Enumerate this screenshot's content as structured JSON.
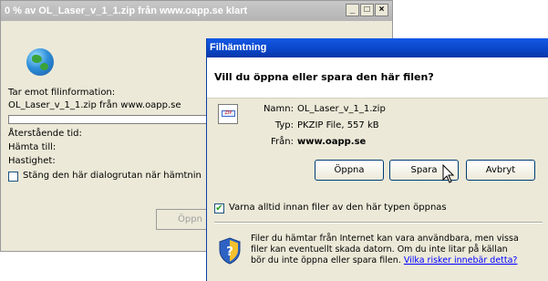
{
  "background_window": {
    "title": "0 % av OL_Laser_v_1_1.zip från www.oapp.se klart",
    "receiving_label": "Tar emot filinformation:",
    "receiving_value": "OL_Laser_v_1_1.zip från www.oapp.se",
    "time_left_label": "Återstående tid:",
    "download_to_label": "Hämta till:",
    "speed_label": "Hastighet:",
    "close_when_done_label": "Stäng den här dialogrutan när hämtnin",
    "open_button_label": "Öppn",
    "progress": 0
  },
  "dialog": {
    "title": "Filhämtning",
    "question": "Vill du öppna eller spara den här filen?",
    "name_label": "Namn:",
    "name_value": "OL_Laser_v_1_1.zip",
    "type_label": "Typ:",
    "type_value": "PKZIP File, 557 kB",
    "from_label": "Från:",
    "from_value": "www.oapp.se",
    "open_button": "Öppna",
    "save_button": "Spara",
    "cancel_button": "Avbryt",
    "always_ask_label": "Varna alltid innan filer av den här typen öppnas",
    "always_ask_checked": true,
    "warning_text": "Filer du hämtar från Internet kan vara användbara, men vissa filer kan eventuellt skada datorn. Om du inte litar på källan bör du inte öppna eller spara filen.",
    "warning_link": "Vilka risker innebär detta?"
  },
  "icons": {
    "globe": "globe-icon",
    "file": "zip-file-icon",
    "shield": "shield-question-icon",
    "cursor": "mouse-pointer-icon"
  }
}
